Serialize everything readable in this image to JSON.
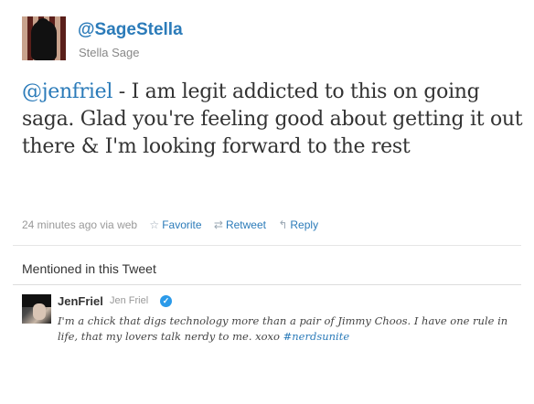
{
  "author": {
    "screen_name": "@SageStella",
    "full_name": "Stella Sage"
  },
  "tweet": {
    "mention": "@jenfriel",
    "text": " - I am legit addicted to this on going saga. Glad you're feeling good about getting it out there & I'm looking forward to the rest"
  },
  "meta": {
    "timestamp": "24 minutes ago via web",
    "favorite_label": "Favorite",
    "retweet_label": "Retweet",
    "reply_label": "Reply"
  },
  "mentioned": {
    "title": "Mentioned in this Tweet",
    "user": {
      "screen_name": "JenFriel",
      "full_name": "Jen Friel",
      "bio": "I'm a chick that digs technology more than a pair of Jimmy Choos. I have one rule in life, that my lovers talk nerdy to me. xoxo ",
      "hashtag": "#nerdsunite"
    }
  },
  "colors": {
    "link": "#2b7bb9",
    "verified": "#2b9ae9"
  }
}
